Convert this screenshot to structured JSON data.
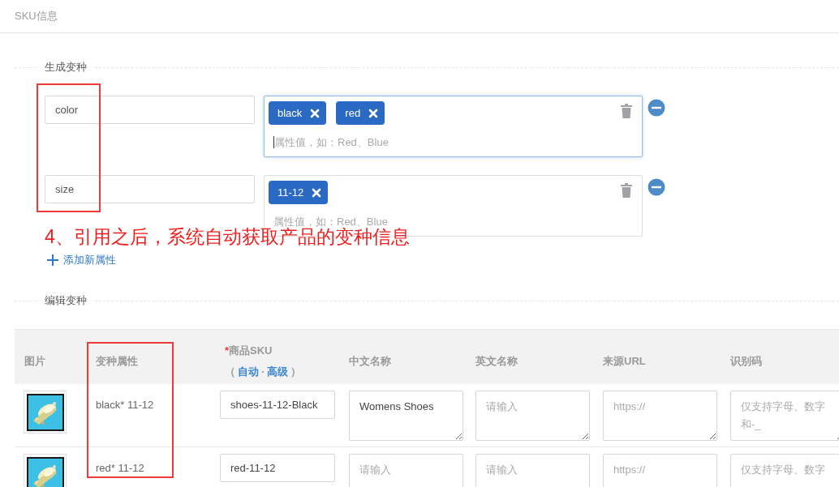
{
  "panel": {
    "title": "SKU信息"
  },
  "generate_section": {
    "legend": "生成变种",
    "attributes": [
      {
        "name": "color",
        "focused": true,
        "values": [
          "black",
          "red"
        ],
        "placeholder": "属性值，如：Red、Blue"
      },
      {
        "name": "size",
        "focused": false,
        "values": [
          "11-12"
        ],
        "placeholder": "属性值，如：Red、Blue"
      }
    ],
    "add_link": "添加新属性"
  },
  "annotation": "4、引用之后，系统自动获取产品的变种信息",
  "edit_section": {
    "legend": "编辑变种",
    "table": {
      "columns": [
        {
          "label": "图片"
        },
        {
          "label": "变种属性"
        },
        {
          "label": "商品SKU",
          "required_mark": "*",
          "options": {
            "open": "（",
            "links": [
              "自动",
              "高级"
            ],
            "separator": "·",
            "close": "）"
          }
        },
        {
          "label": "中文名称"
        },
        {
          "label": "英文名称"
        },
        {
          "label": "来源URL"
        },
        {
          "label": "识别码"
        }
      ],
      "rows": [
        {
          "variant": "black* 11-12",
          "fields": [
            {
              "kind": "input",
              "value": "shoes-11-12-Black"
            },
            {
              "kind": "textarea",
              "value": "Womens Shoes"
            },
            {
              "kind": "textarea",
              "placeholder": "请输入"
            },
            {
              "kind": "textarea",
              "placeholder": "https://"
            },
            {
              "kind": "textarea",
              "placeholder": "仅支持字母、数字和-_"
            }
          ]
        },
        {
          "variant": "red* 11-12",
          "fields": [
            {
              "kind": "input",
              "value": "red-11-12"
            },
            {
              "kind": "textarea",
              "placeholder": "请输入"
            },
            {
              "kind": "textarea",
              "placeholder": "请输入"
            },
            {
              "kind": "textarea",
              "placeholder": "https://"
            },
            {
              "kind": "textarea",
              "placeholder": "仅支持字母、数字"
            }
          ]
        }
      ]
    }
  }
}
